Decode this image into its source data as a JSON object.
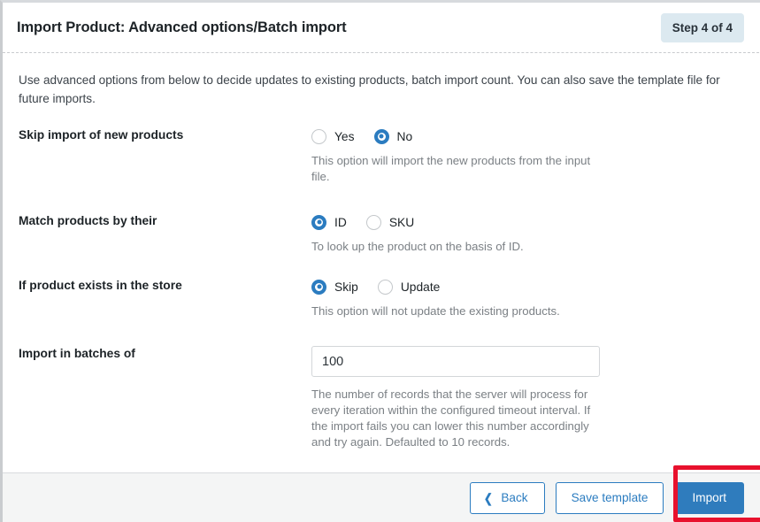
{
  "header": {
    "title": "Import Product: Advanced options/Batch import",
    "step_badge": "Step 4 of 4"
  },
  "intro": "Use advanced options from below to decide updates to existing products, batch import count. You can also save the template file for future imports.",
  "options": [
    {
      "label": "Skip import of new products",
      "choices": [
        {
          "label": "Yes",
          "selected": false
        },
        {
          "label": "No",
          "selected": true
        }
      ],
      "hint": "This option will import the new products from the input file."
    },
    {
      "label": "Match products by their",
      "choices": [
        {
          "label": "ID",
          "selected": true
        },
        {
          "label": "SKU",
          "selected": false
        }
      ],
      "hint": "To look up the product on the basis of ID."
    },
    {
      "label": "If product exists in the store",
      "choices": [
        {
          "label": "Skip",
          "selected": true
        },
        {
          "label": "Update",
          "selected": false
        }
      ],
      "hint": "This option will not update the existing products."
    }
  ],
  "batch": {
    "label": "Import in batches of",
    "value": "100",
    "placeholder": "100",
    "hint": "The number of records that the server will process for every iteration within the configured timeout interval. If the import fails you can lower this number accordingly and try again. Defaulted to 10 records."
  },
  "footer": {
    "back_label": "Back",
    "back_icon": "chevron-left-icon",
    "save_template_label": "Save template",
    "import_label": "Import"
  },
  "colors": {
    "accent_blue": "#2b7cc0",
    "primary_button": "#2f7cbd",
    "badge_background": "#dce9f0",
    "highlight_red": "#e8112d",
    "footer_background": "#f4f5f5"
  }
}
